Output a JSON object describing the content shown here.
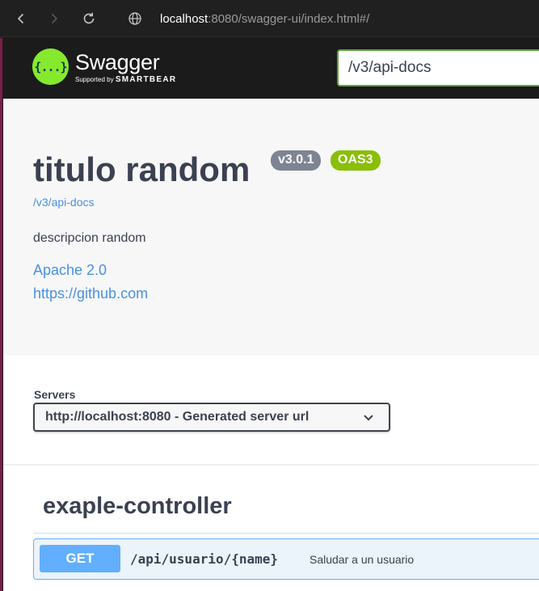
{
  "browser": {
    "url_host": "localhost",
    "url_rest": ":8080/swagger-ui/index.html#/",
    "icons": [
      "back-icon",
      "forward-icon",
      "reload-icon",
      "globe-icon"
    ]
  },
  "topbar": {
    "logo_name": "Swagger",
    "logo_glyph": "{...}",
    "logo_supported": "Supported by",
    "logo_brand": "SMARTBEAR",
    "spec_input_value": "/v3/api-docs"
  },
  "info": {
    "title": "titulo random",
    "version_badge": "v3.0.1",
    "oas_badge": "OAS3",
    "spec_url": "/v3/api-docs",
    "description": "descripcion random",
    "license_link": "Apache 2.0",
    "external_link": "https://github.com"
  },
  "servers": {
    "label": "Servers",
    "selected": "http://localhost:8080 - Generated server url"
  },
  "tags": [
    {
      "name": "exaple-controller",
      "operations": [
        {
          "method": "GET",
          "path": "/api/usuario/{name}",
          "summary": "Saludar a un usuario"
        }
      ]
    }
  ],
  "colors": {
    "accent_green": "#85ea2d",
    "get_blue": "#61affe",
    "link_blue": "#4990e2",
    "oas_green": "#89bf04",
    "version_gray": "#7d8492"
  }
}
